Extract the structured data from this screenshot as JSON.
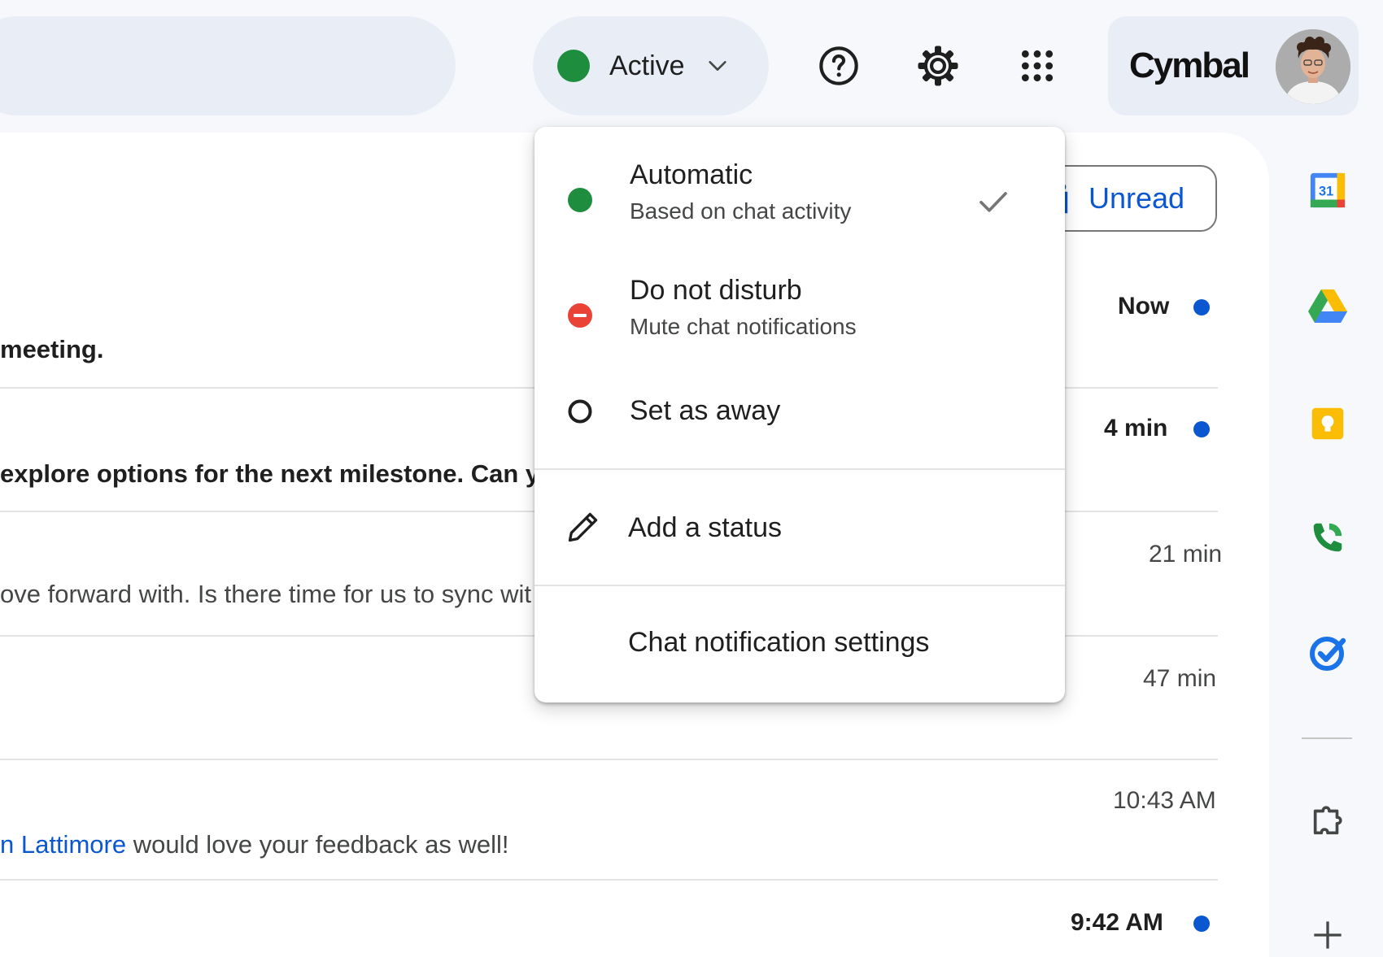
{
  "header": {
    "status": {
      "label": "Active",
      "color": "#1e8e3e"
    },
    "icons": [
      "help-icon",
      "gear-icon",
      "apps-grid-icon"
    ],
    "brand": "Cymbal"
  },
  "filter": {
    "unread_label": "Unread"
  },
  "messages": [
    {
      "text": "meeting.",
      "time": "Now",
      "bold": true,
      "unread": true
    },
    {
      "text": "explore options for the next milestone. Can yo",
      "time": "4 min",
      "bold": true,
      "unread": true
    },
    {
      "text": "ove forward with. Is there time for us to sync wit",
      "time": "21 min",
      "bold": false,
      "unread": false
    },
    {
      "text": "",
      "time": "47 min",
      "bold": false,
      "unread": false
    },
    {
      "mention": "n Lattimore",
      "text": " would love your feedback as well!",
      "time": "10:43 AM",
      "bold": false,
      "unread": false
    },
    {
      "text": "",
      "time": "9:42 AM",
      "bold": true,
      "unread": true
    }
  ],
  "status_menu": {
    "automatic": {
      "title": "Automatic",
      "subtitle": "Based on chat activity",
      "selected": true
    },
    "dnd": {
      "title": "Do not disturb",
      "subtitle": "Mute chat notifications"
    },
    "away": {
      "title": "Set as away"
    },
    "add_status": {
      "title": "Add a status"
    },
    "notif_settings": {
      "title": "Chat notification settings"
    }
  },
  "rail": {
    "calendar_day": "31",
    "icons": [
      "calendar-icon",
      "drive-icon",
      "keep-icon",
      "voice-icon",
      "tasks-icon",
      "addons-icon",
      "add-icon"
    ]
  },
  "colors": {
    "accent": "#0b57d0",
    "active_green": "#1e8e3e",
    "dnd_red": "#ea4335",
    "unread_dot": "#0b57d0"
  }
}
